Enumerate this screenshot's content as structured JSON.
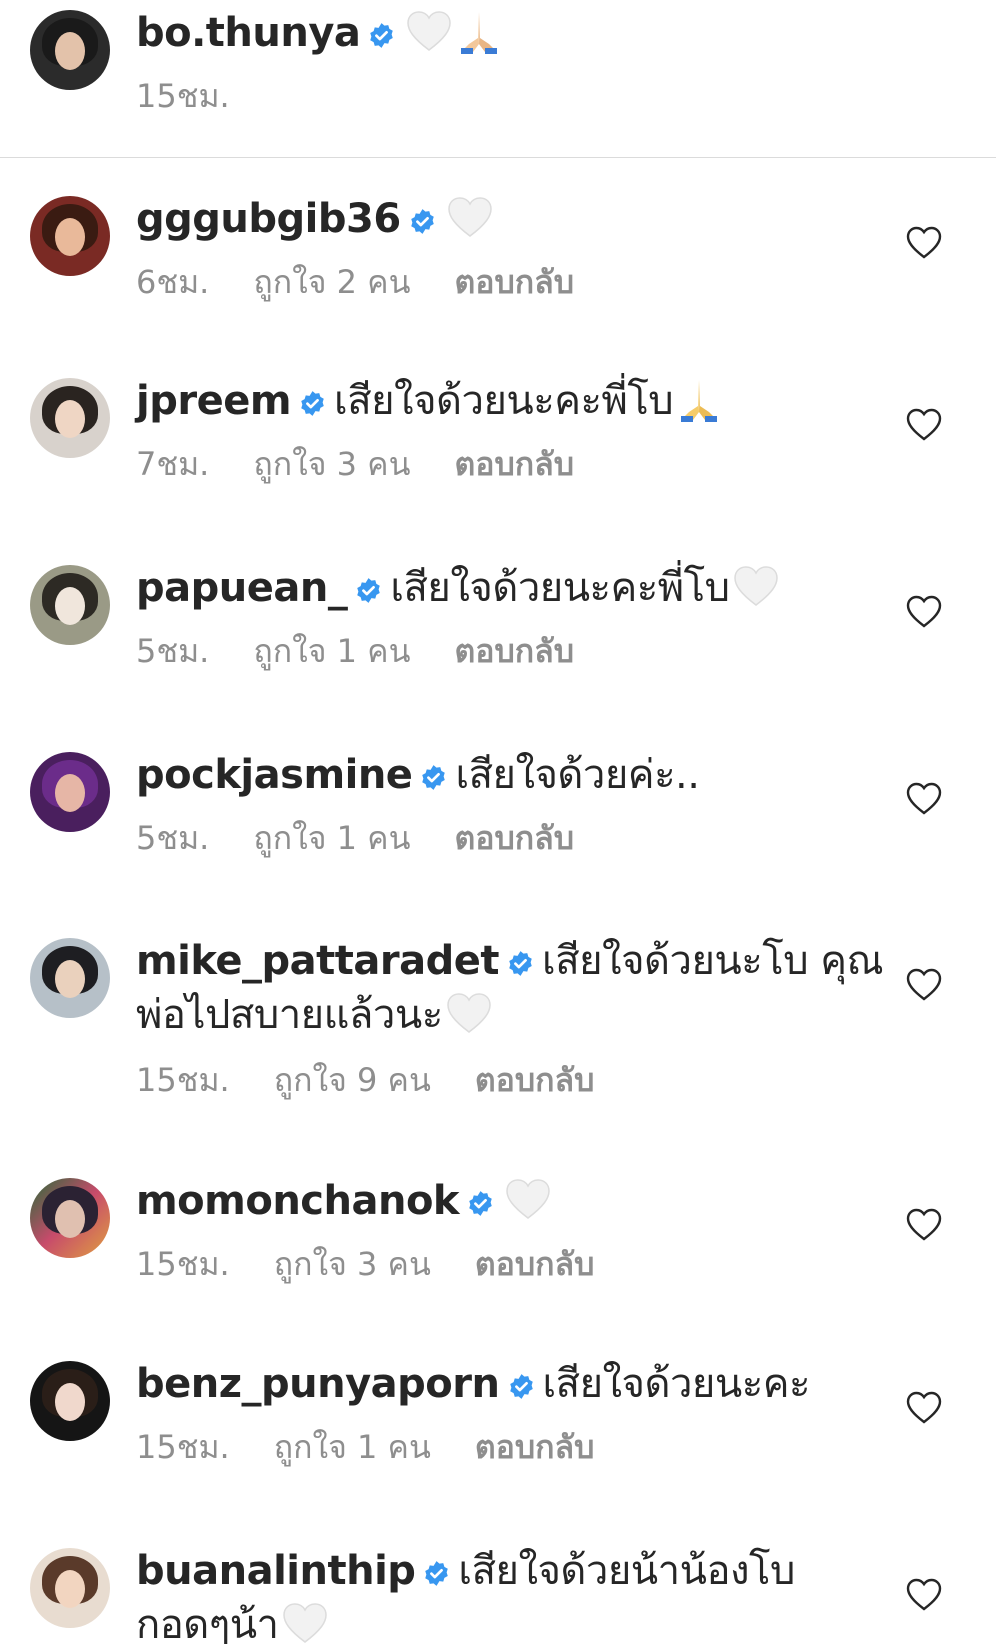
{
  "caption": {
    "username": "bo.thunya",
    "time": "15ชม."
  },
  "comments": [
    {
      "username": "gggubgib36",
      "text": "",
      "emoji": "white-heart",
      "time": "6ชม.",
      "likes": "ถูกใจ 2 คน",
      "reply": "ตอบกลับ"
    },
    {
      "username": "jpreem",
      "text": "เสียใจด้วยนะคะพี่โบ",
      "emoji": "folded-hands",
      "time": "7ชม.",
      "likes": "ถูกใจ 3 คน",
      "reply": "ตอบกลับ"
    },
    {
      "username": "papuean_",
      "text": "เสียใจด้วยนะคะพี่โบ",
      "emoji": "white-heart",
      "time": "5ชม.",
      "likes": "ถูกใจ 1 คน",
      "reply": "ตอบกลับ"
    },
    {
      "username": "pockjasmine",
      "text": "เสียใจด้วยค่ะ..",
      "emoji": "",
      "time": "5ชม.",
      "likes": "ถูกใจ 1 คน",
      "reply": "ตอบกลับ"
    },
    {
      "username": "mike_pattaradet",
      "text": "เสียใจด้วยนะโบ คุณพ่อไปสบายแล้วนะ",
      "emoji": "white-heart",
      "time": "15ชม.",
      "likes": "ถูกใจ 9 คน",
      "reply": "ตอบกลับ"
    },
    {
      "username": "momonchanok",
      "text": "",
      "emoji": "white-heart",
      "time": "15ชม.",
      "likes": "ถูกใจ 3 คน",
      "reply": "ตอบกลับ"
    },
    {
      "username": "benz_punyaporn",
      "text": "เสียใจด้วยนะคะ",
      "emoji": "",
      "time": "15ชม.",
      "likes": "ถูกใจ 1 คน",
      "reply": "ตอบกลับ"
    },
    {
      "username": "buanalinthip",
      "text": "เสียใจด้วยน้าน้องโบ กอดๆน้า",
      "emoji": "white-heart",
      "time": "",
      "likes": "",
      "reply": ""
    }
  ],
  "colors": {
    "verified": "#3897f0",
    "meta": "#8e8e8e",
    "text": "#262626",
    "divider": "#dbdbdb"
  }
}
